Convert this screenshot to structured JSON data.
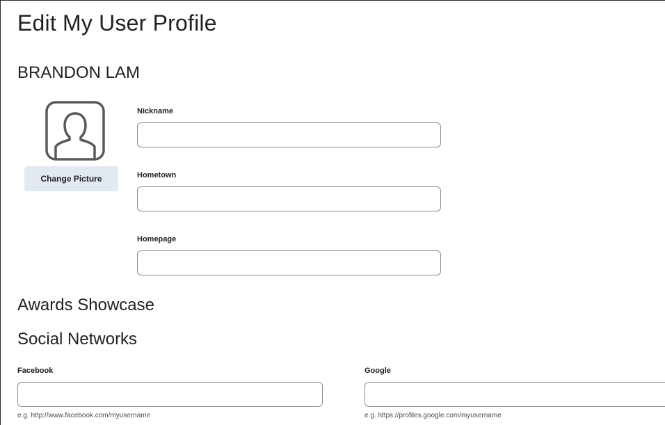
{
  "page": {
    "title": "Edit My User Profile",
    "user_name": "BRANDON LAM"
  },
  "profile": {
    "avatar_icon": "user-silhouette-icon",
    "change_picture_label": "Change Picture",
    "fields": {
      "nickname": {
        "label": "Nickname",
        "value": ""
      },
      "hometown": {
        "label": "Hometown",
        "value": ""
      },
      "homepage": {
        "label": "Homepage",
        "value": ""
      }
    }
  },
  "sections": {
    "awards_title": "Awards Showcase",
    "social_title": "Social Networks"
  },
  "social": {
    "facebook": {
      "label": "Facebook",
      "value": "",
      "help": "e.g. http://www.facebook.com/myusername"
    },
    "google": {
      "label": "Google",
      "value": "",
      "help": "e.g. https://profiles.google.com/myusername"
    }
  },
  "colors": {
    "button_bg": "#e3e9f1",
    "input_border": "#8a8c8f",
    "text": "#202122",
    "icon_stroke": "#565a5c"
  }
}
